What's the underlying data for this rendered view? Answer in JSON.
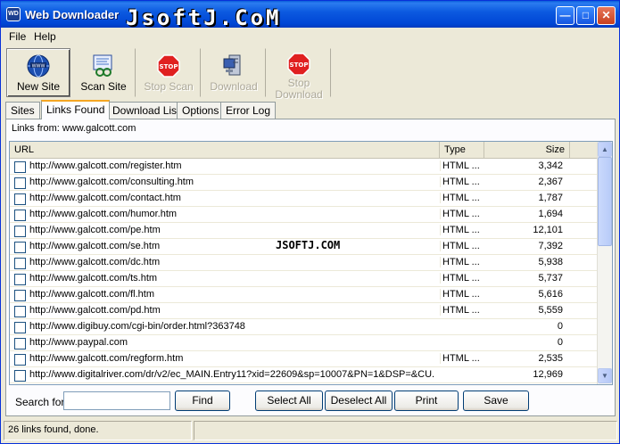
{
  "window": {
    "title": "Web Downloader",
    "watermark_top": "JsoftJ.CoM",
    "icon_text": "WD"
  },
  "menu": {
    "file": "File",
    "help": "Help"
  },
  "toolbar": {
    "new_site": "New Site",
    "scan_site": "Scan Site",
    "stop_scan": "Stop Scan",
    "download": "Download",
    "stop_download_line1": "Stop",
    "stop_download_line2": "Download",
    "stop_sign_text": "STOP"
  },
  "tabs": [
    "Sites",
    "Links Found",
    "Download List",
    "Options",
    "Error Log"
  ],
  "links_from": "Links from: www.galcott.com",
  "list": {
    "columns": {
      "url": "URL",
      "type": "Type",
      "size": "Size"
    },
    "rows": [
      {
        "url": "http://www.galcott.com/register.htm",
        "type": "HTML ...",
        "size": "3,342"
      },
      {
        "url": "http://www.galcott.com/consulting.htm",
        "type": "HTML ...",
        "size": "2,367"
      },
      {
        "url": "http://www.galcott.com/contact.htm",
        "type": "HTML ...",
        "size": "1,787"
      },
      {
        "url": "http://www.galcott.com/humor.htm",
        "type": "HTML ...",
        "size": "1,694"
      },
      {
        "url": "http://www.galcott.com/pe.htm",
        "type": "HTML ...",
        "size": "12,101"
      },
      {
        "url": "http://www.galcott.com/se.htm",
        "type": "HTML ...",
        "size": "7,392"
      },
      {
        "url": "http://www.galcott.com/dc.htm",
        "type": "HTML ...",
        "size": "5,938"
      },
      {
        "url": "http://www.galcott.com/ts.htm",
        "type": "HTML ...",
        "size": "5,737"
      },
      {
        "url": "http://www.galcott.com/fl.htm",
        "type": "HTML ...",
        "size": "5,616"
      },
      {
        "url": "http://www.galcott.com/pd.htm",
        "type": "HTML ...",
        "size": "5,559"
      },
      {
        "url": "http://www.digibuy.com/cgi-bin/order.html?363748",
        "type": "",
        "size": "0"
      },
      {
        "url": "http://www.paypal.com",
        "type": "",
        "size": "0"
      },
      {
        "url": "http://www.galcott.com/regform.htm",
        "type": "HTML ...",
        "size": "2,535"
      },
      {
        "url": "http://www.digitalriver.com/dr/v2/ec_MAIN.Entry11?xid=22609&sp=10007&PN=1&DSP=&CU...",
        "type": "",
        "size": "12,969"
      }
    ]
  },
  "watermark_mid": "JSOFTJ.COM",
  "bottom": {
    "search_label": "Search for",
    "search_value": "",
    "find": "Find",
    "select_all": "Select All",
    "deselect_all": "Deselect All",
    "print": "Print",
    "save": "Save"
  },
  "status": {
    "text": "26 links found, done.",
    "pane2": ""
  }
}
